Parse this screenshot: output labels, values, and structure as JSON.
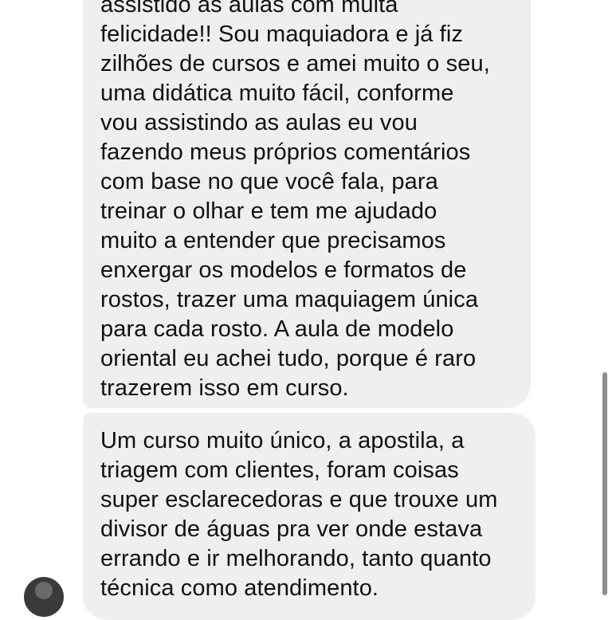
{
  "conversation": {
    "messages": [
      {
        "lines": [
          "assistido as aulas com muita",
          "felicidade!! Sou maquiadora e já fiz",
          "zilhões de cursos e amei muito o seu,",
          "uma didática muito fácil, conforme",
          "vou assistindo as aulas eu vou",
          "fazendo meus próprios comentários",
          "com base no que você fala, para",
          "treinar o olhar e tem me ajudado",
          "muito a entender que precisamos",
          "enxergar os modelos e formatos de",
          "rostos, trazer uma maquiagem única",
          "para cada rosto. A aula de modelo",
          "oriental eu achei tudo, porque é raro",
          "trazerem isso em curso."
        ]
      },
      {
        "lines": [
          "Um curso muito único, a apostila, a",
          "triagem com clientes, foram coisas",
          "super esclarecedoras e que trouxe um",
          "divisor de águas pra ver onde estava",
          "errando e ir melhorando, tanto quanto",
          "técnica como atendimento."
        ]
      }
    ]
  },
  "colors": {
    "bubble_background": "#efefef",
    "text": "#111111",
    "scrollbar": "#8f8f8f"
  }
}
